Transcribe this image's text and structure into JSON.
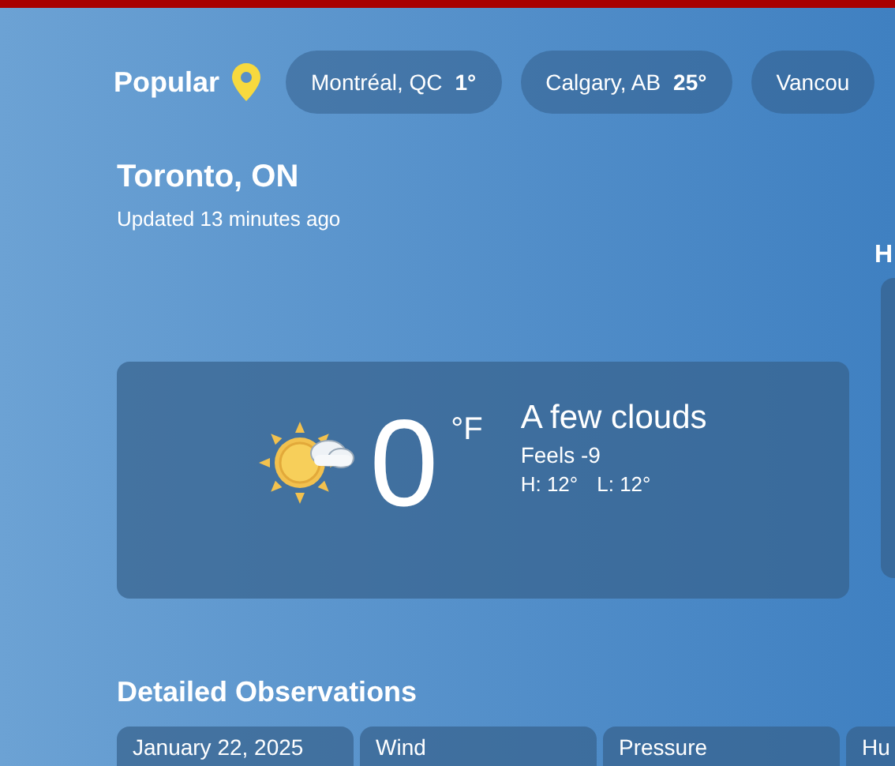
{
  "popular": {
    "label": "Popular",
    "cities": [
      {
        "name": "Montréal, QC",
        "temp": "1°"
      },
      {
        "name": "Calgary, AB",
        "temp": "25°"
      },
      {
        "name": "Vancou"
      }
    ]
  },
  "location": {
    "title": "Toronto, ON",
    "updated": "Updated 13 minutes ago"
  },
  "side_panel": {
    "heading": "H"
  },
  "current": {
    "temperature": "0",
    "unit": "°F",
    "condition": "A few clouds",
    "feels": "Feels -9",
    "high": "H: 12°",
    "low": "L: 12°"
  },
  "observations": {
    "heading": "Detailed Observations",
    "cards": [
      "January 22, 2025",
      "Wind",
      "Pressure",
      "Hu"
    ]
  }
}
